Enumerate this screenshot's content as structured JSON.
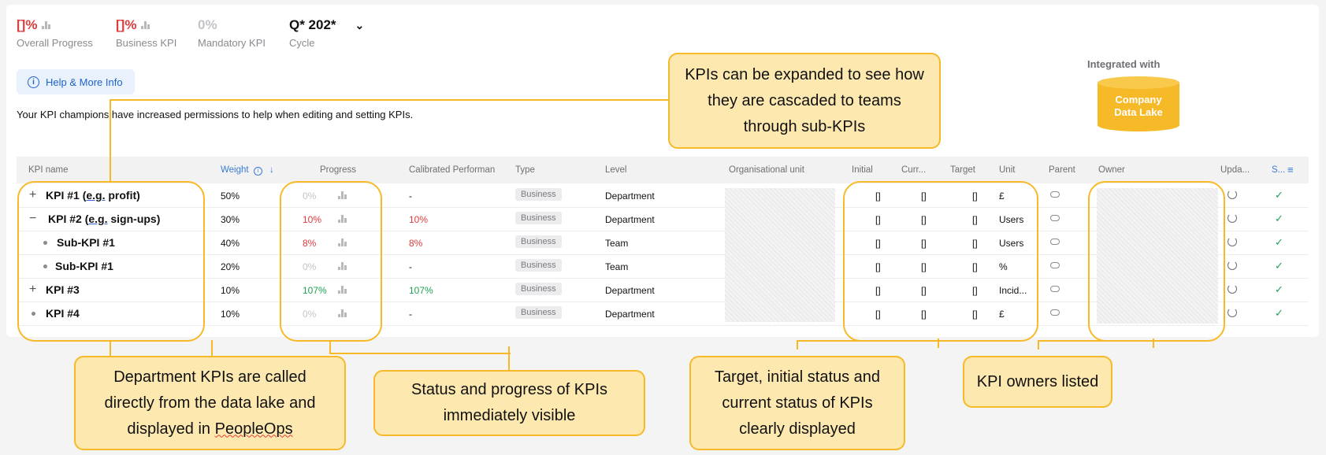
{
  "stats": [
    {
      "value": "[]%",
      "label": "Overall Progress"
    },
    {
      "value": "[]%",
      "label": "Business KPI"
    },
    {
      "value": "0%",
      "label": "Mandatory KPI"
    },
    {
      "value": "Q* 202*",
      "label": "Cycle"
    }
  ],
  "help_label": "Help & More Info",
  "notice": "Your KPI champions have increased permissions to help when editing and setting KPIs.",
  "integrated_label": "Integrated with",
  "datalake_line1": "Company",
  "datalake_line2": "Data Lake",
  "headers": [
    "KPI name",
    "Weight",
    "Progress",
    "Calibrated Performan",
    "Type",
    "Level",
    "Organisational unit",
    "Initial",
    "Curr...",
    "Target",
    "Unit",
    "Parent",
    "Owner",
    "Upda...",
    "S..."
  ],
  "rows": [
    {
      "pre": "KPI #1 (",
      "eg": "e.g.",
      "post": " profit)",
      "weight": "50%",
      "progress": "0%",
      "calibrated": "-",
      "type": "Business",
      "level": "Department",
      "initial": "[]",
      "current": "[]",
      "target": "[]",
      "unit": "£"
    },
    {
      "pre": "KPI #2 (",
      "eg": "e.g.",
      "post": " sign-ups)",
      "weight": "30%",
      "progress": "10%",
      "calibrated": "10%",
      "type": "Business",
      "level": "Department",
      "initial": "[]",
      "current": "[]",
      "target": "[]",
      "unit": "Users"
    },
    {
      "pre": "Sub-KPI #1",
      "eg": "",
      "post": "",
      "weight": "40%",
      "progress": "8%",
      "calibrated": "8%",
      "type": "Business",
      "level": "Team",
      "initial": "[]",
      "current": "[]",
      "target": "[]",
      "unit": "Users"
    },
    {
      "pre": "Sub-KPI #1",
      "eg": "",
      "post": "",
      "weight": "20%",
      "progress": "0%",
      "calibrated": "-",
      "type": "Business",
      "level": "Team",
      "initial": "[]",
      "current": "[]",
      "target": "[]",
      "unit": "%"
    },
    {
      "pre": "KPI #3",
      "eg": "",
      "post": "",
      "weight": "10%",
      "progress": "107%",
      "calibrated": "107%",
      "type": "Business",
      "level": "Department",
      "initial": "[]",
      "current": "[]",
      "target": "[]",
      "unit": "Incid..."
    },
    {
      "pre": "KPI #4",
      "eg": "",
      "post": "",
      "weight": "10%",
      "progress": "0%",
      "calibrated": "-",
      "type": "Business",
      "level": "Department",
      "initial": "[]",
      "current": "[]",
      "target": "[]",
      "unit": "£"
    }
  ],
  "callouts": {
    "expand_l1": "KPIs can be expanded to see how",
    "expand_l2": "they are cascaded to teams",
    "expand_l3": "through sub-KPIs",
    "dept_l1": "Department KPIs are called",
    "dept_l2": "directly from the data lake and",
    "dept_l3a": "displayed in ",
    "dept_l3b": "PeopleOps",
    "status_l1": "Status and progress of KPIs",
    "status_l2": "immediately visible",
    "target_l1": "Target, initial status and",
    "target_l2": "current status of KPIs",
    "target_l3": "clearly displayed",
    "owners": "KPI owners listed"
  },
  "colors": {
    "accent_yellow": "#f6b928",
    "callout_fill": "#fde9b0",
    "red": "#e23b3b",
    "green": "#1fa355",
    "blue": "#1f63c9"
  }
}
